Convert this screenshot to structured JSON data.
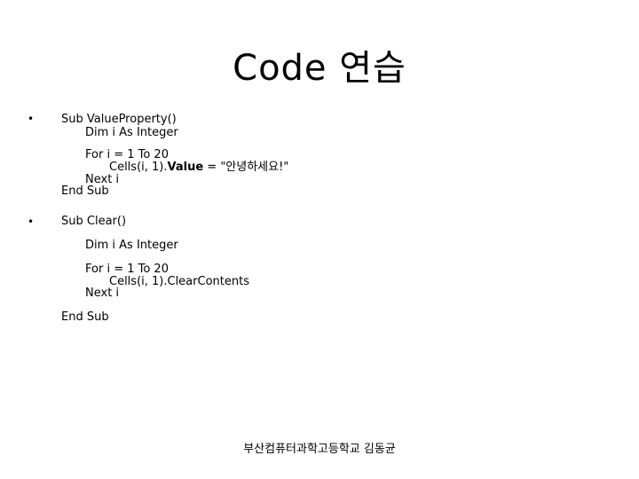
{
  "slide": {
    "title": "Code 연습",
    "bullet_glyph": "•",
    "blocks": [
      {
        "lines": [
          "Sub ValueProperty()",
          "Dim i As Integer",
          "For i = 1 To 20",
          "Next i",
          "End Sub"
        ],
        "cells_line": {
          "prefix": "Cells(i, 1).",
          "bold": "Value",
          "suffix": " = \"안녕하세요!\""
        }
      },
      {
        "lines": [
          "Sub Clear()",
          "Dim i As Integer",
          "For i = 1 To 20",
          "Cells(i, 1).ClearContents",
          "Next i",
          "End Sub"
        ]
      }
    ],
    "footer": "부산컴퓨터과학고등학교 김동균"
  }
}
